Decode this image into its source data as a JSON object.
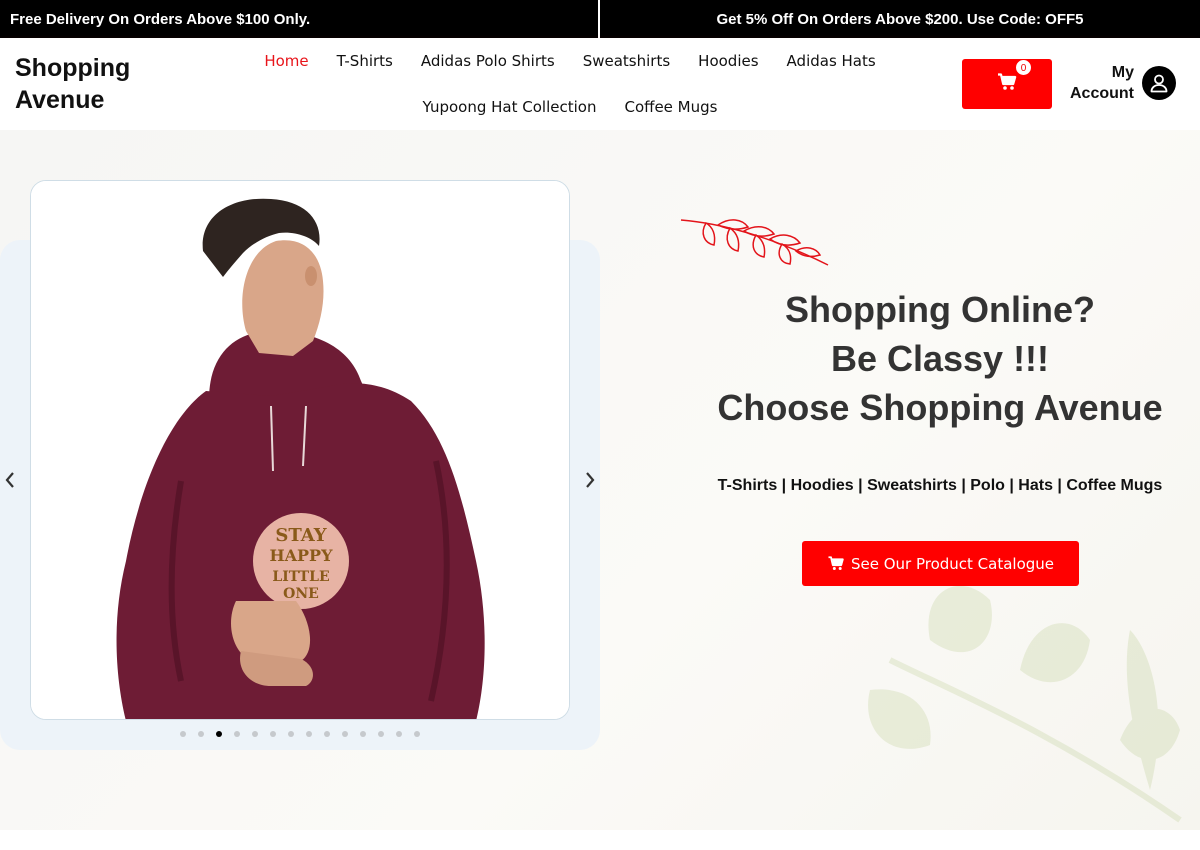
{
  "promo": {
    "left": "Free Delivery On Orders Above $100 Only.",
    "right": "Get 5% Off On Orders Above $200. Use Code: OFF5"
  },
  "header": {
    "logo_line1": "Shopping",
    "logo_line2": "Avenue",
    "nav_row1": [
      "Home",
      "T-Shirts",
      "Adidas Polo Shirts",
      "Sweatshirts",
      "Hoodies",
      "Adidas Hats"
    ],
    "nav_row2": [
      "Yupoong Hat Collection",
      "Coffee Mugs"
    ],
    "cart_count": "0",
    "account_line1": "My",
    "account_line2": "Account"
  },
  "hero": {
    "headline_line1": "Shopping Online?",
    "headline_line2": "Be Classy !!!",
    "headline_line3": "Choose Shopping Avenue",
    "tagline": "T-Shirts | Hoodies | Sweatshirts | Polo | Hats | Coffee Mugs",
    "cta_label": "See Our Product Catalogue",
    "slider_total": 14,
    "slider_active": 3
  },
  "icons": {
    "cart": "cart-icon",
    "account": "user-icon",
    "prev": "chevron-left-icon",
    "next": "chevron-right-icon"
  },
  "colors": {
    "accent": "#ff0000",
    "nav_active": "#e8141a",
    "hoodie": "#6e1c35"
  }
}
